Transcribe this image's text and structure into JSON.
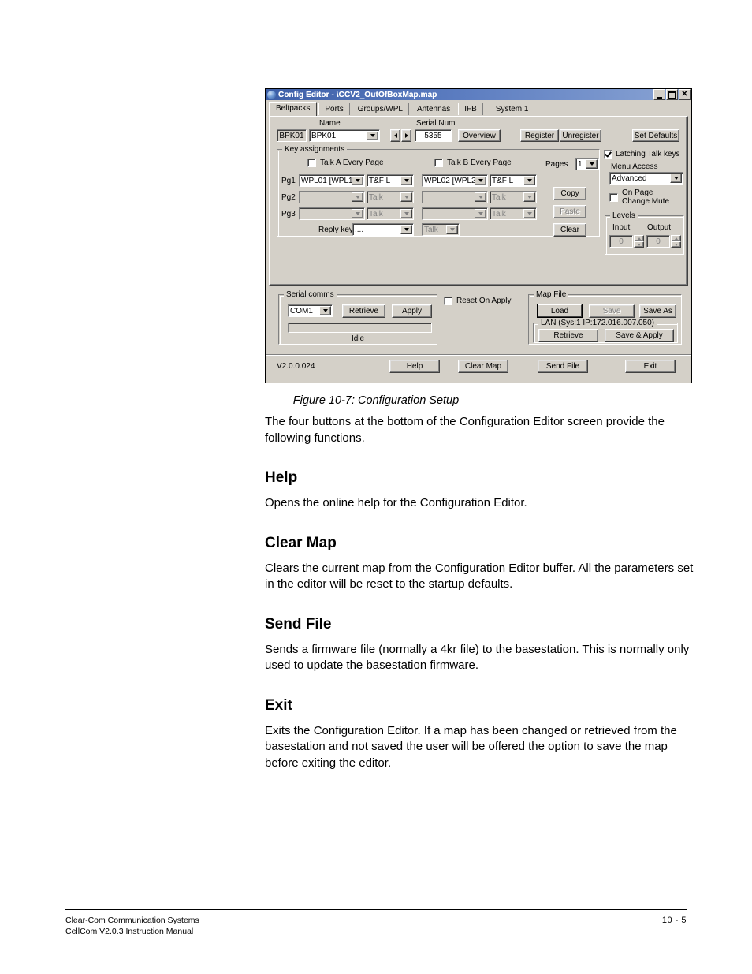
{
  "document": {
    "caption": "Figure 10-7: Configuration Setup",
    "intro": "The four buttons at the bottom of the Configuration Editor screen provide the following functions.",
    "sections": [
      {
        "heading": "Help",
        "body": "Opens the online help for the Configuration Editor."
      },
      {
        "heading": "Clear Map",
        "body": "Clears the current map from the Configuration Editor buffer.  All the parameters set in the editor will be reset to the startup defaults."
      },
      {
        "heading": "Send File",
        "body": "Sends a firmware file (normally a 4kr file) to the basestation.  This is normally only used to update the basestation firmware."
      },
      {
        "heading": "Exit",
        "body": "Exits the Configuration Editor.  If a map has been changed or retrieved from the basestation and not saved the user will be offered the option to save the map before exiting the editor."
      }
    ],
    "footer": {
      "line1": "Clear-Com Communication Systems",
      "line2": "CellCom V2.0.3 Instruction Manual",
      "page": "10 - 5"
    }
  },
  "dialog": {
    "title": "Config Editor - \\CCV2_OutOfBoxMap.map",
    "window_buttons": {
      "minimize": "minimize-icon",
      "maximize": "maximize-icon",
      "close": "close-icon"
    },
    "tabs": [
      {
        "label": "Beltpacks",
        "active": true
      },
      {
        "label": "Ports",
        "active": false
      },
      {
        "label": "Groups/WPL",
        "active": false
      },
      {
        "label": "Antennas",
        "active": false
      },
      {
        "label": "IFB",
        "active": false
      },
      {
        "label": "System 1",
        "active": false
      }
    ],
    "beltpack": {
      "name_label": "Name",
      "serial_label": "Serial Num",
      "id_value": "BPK01",
      "name_value": "BPK01",
      "serial_value": "5355",
      "prev_label": "previous-beltpack",
      "next_label": "next-beltpack",
      "overview_label": "Overview",
      "register_label": "Register",
      "unregister_label": "Unregister",
      "set_defaults_label": "Set Defaults"
    },
    "key_assignments": {
      "group_label": "Key assignments",
      "talk_a_label": "Talk A Every Page",
      "talk_a_checked": false,
      "talk_b_label": "Talk B Every Page",
      "talk_b_checked": false,
      "pages_label": "Pages",
      "pages_value": "1",
      "rows": [
        {
          "label": "Pg1",
          "a_source": "WPL01 [WPL1",
          "a_mode": "T&F L",
          "b_source": "WPL02 [WPL2",
          "b_mode": "T&F L",
          "enabled": true
        },
        {
          "label": "Pg2",
          "a_source": "",
          "a_mode": "Talk",
          "b_source": "",
          "b_mode": "Talk",
          "enabled": false
        },
        {
          "label": "Pg3",
          "a_source": "",
          "a_mode": "Talk",
          "b_source": "",
          "b_mode": "Talk",
          "enabled": false
        }
      ],
      "reply_key_label": "Reply key",
      "reply_key_value": "....",
      "reply_key_mode": "Talk",
      "copy_label": "Copy",
      "paste_label": "Paste",
      "clear_label": "Clear"
    },
    "options": {
      "latching_label": "Latching Talk keys",
      "latching_checked": true,
      "menu_access_label": "Menu Access",
      "menu_access_value": "Advanced",
      "on_page_line1": "On Page",
      "on_page_line2": "Change Mute",
      "on_page_checked": false,
      "levels_label": "Levels",
      "input_label": "Input",
      "input_value": "0",
      "output_label": "Output",
      "output_value": "0"
    },
    "serial_comms": {
      "group_label": "Serial comms",
      "port_value": "COM1",
      "retrieve_label": "Retrieve",
      "apply_label": "Apply",
      "progress_value": "",
      "status_text": "Idle"
    },
    "reset_on_apply": {
      "label": "Reset On Apply",
      "checked": false
    },
    "map_file": {
      "group_label": "Map File",
      "load_label": "Load",
      "save_label": "Save",
      "save_as_label": "Save As",
      "lan_label": "LAN  (Sys:1 IP:172.016.007.050)",
      "lan_retrieve_label": "Retrieve",
      "save_apply_label": "Save & Apply"
    },
    "statusbar": {
      "version": "V2.0.0.024",
      "help_label": "Help",
      "clear_map_label": "Clear Map",
      "send_file_label": "Send File",
      "exit_label": "Exit"
    },
    "colors": {
      "face": "#d4d0c8",
      "title_left": "#3d5fa8",
      "title_right": "#8aa4d4",
      "field": "#ffffff",
      "disabled_text": "#808080"
    }
  }
}
